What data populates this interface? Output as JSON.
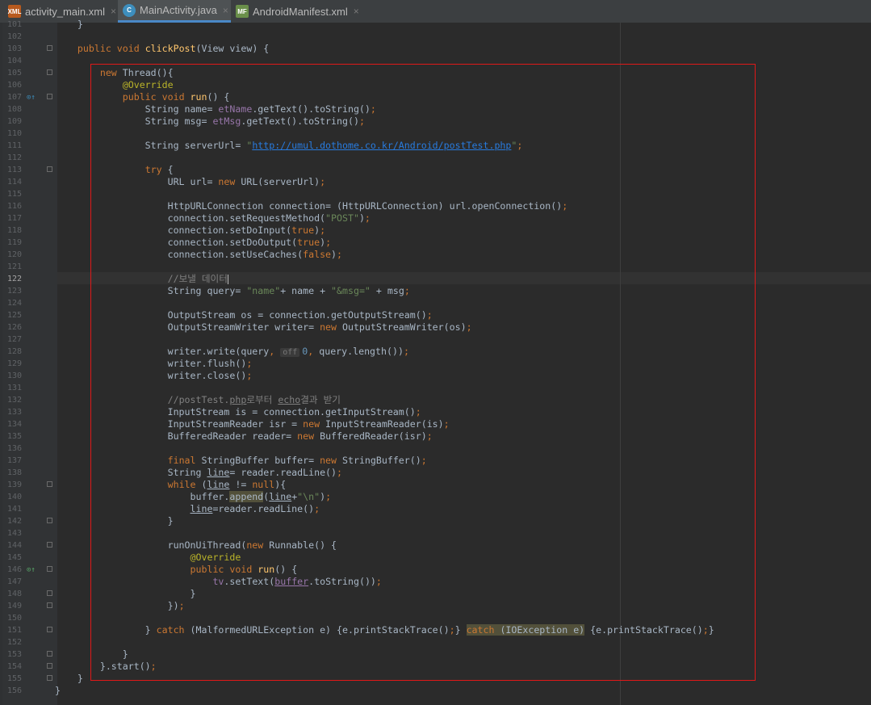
{
  "tabs": [
    {
      "label": "activity_main.xml",
      "icon": "xml-file-icon",
      "active": false,
      "icon_text": "XML"
    },
    {
      "label": "MainActivity.java",
      "icon": "java-class-icon",
      "active": true,
      "icon_text": "C"
    },
    {
      "label": "AndroidManifest.xml",
      "icon": "manifest-file-icon",
      "active": false,
      "icon_text": "MF"
    }
  ],
  "close_glyph": "×",
  "current_line": 122,
  "colors": {
    "keyword": "#cc7832",
    "string": "#6a8759",
    "annotation": "#bbb529",
    "field": "#9876aa",
    "method_decl": "#ffc66d",
    "comment": "#808080",
    "highlight_box": "#e01818"
  },
  "lines": [
    {
      "n": 101,
      "html": "    }"
    },
    {
      "n": 102,
      "html": ""
    },
    {
      "n": 103,
      "html": "    <span class='kw'>public void</span> <span class='fn'>clickPost</span>(View view) {"
    },
    {
      "n": 104,
      "html": ""
    },
    {
      "n": 105,
      "html": "        <span class='kw'>new</span> Thread(){"
    },
    {
      "n": 106,
      "html": "            <span class='ann'>@Override</span>"
    },
    {
      "n": 107,
      "html": "            <span class='kw'>public void</span> <span class='fn'>run</span>() {"
    },
    {
      "n": 108,
      "html": "                String name= <span class='fld'>etName</span>.getText().toString()<span class='kw'>;</span>"
    },
    {
      "n": 109,
      "html": "                String msg= <span class='fld'>etMsg</span>.getText().toString()<span class='kw'>;</span>"
    },
    {
      "n": 110,
      "html": ""
    },
    {
      "n": 111,
      "html": "                String serverUrl= <span class='str'>\"<span class='url'>http://umul.dothome.co.kr/Android/postTest.php</span>\"</span><span class='kw'>;</span>"
    },
    {
      "n": 112,
      "html": ""
    },
    {
      "n": 113,
      "html": "                <span class='kw'>try</span> {"
    },
    {
      "n": 114,
      "html": "                    URL url= <span class='kw'>new</span> URL(serverUrl)<span class='kw'>;</span>"
    },
    {
      "n": 115,
      "html": ""
    },
    {
      "n": 116,
      "html": "                    HttpURLConnection connection= (HttpURLConnection) url.openConnection()<span class='kw'>;</span>"
    },
    {
      "n": 117,
      "html": "                    connection.setRequestMethod(<span class='str'>\"POST\"</span>)<span class='kw'>;</span>"
    },
    {
      "n": 118,
      "html": "                    connection.setDoInput(<span class='kw'>true</span>)<span class='kw'>;</span>"
    },
    {
      "n": 119,
      "html": "                    connection.setDoOutput(<span class='kw'>true</span>)<span class='kw'>;</span>"
    },
    {
      "n": 120,
      "html": "                    connection.setUseCaches(<span class='kw'>false</span>)<span class='kw'>;</span>"
    },
    {
      "n": 121,
      "html": ""
    },
    {
      "n": 122,
      "html": "                    <span class='cmt'>//보낼 데이터</span><span class='cursor'></span>"
    },
    {
      "n": 123,
      "html": "                    String query= <span class='str'>\"name\"</span>+ name + <span class='str'>\"&amp;msg=\"</span> + msg<span class='kw'>;</span>"
    },
    {
      "n": 124,
      "html": ""
    },
    {
      "n": 125,
      "html": "                    OutputStream os = connection.getOutputStream()<span class='kw'>;</span>"
    },
    {
      "n": 126,
      "html": "                    OutputStreamWriter writer= <span class='kw'>new</span> OutputStreamWriter(os)<span class='kw'>;</span>"
    },
    {
      "n": 127,
      "html": ""
    },
    {
      "n": 128,
      "html": "                    writer.write(query<span class='kw'>,</span> <span class='hint'>off</span><span style='color:#6897bb'>0</span><span class='kw'>,</span> query.length())<span class='kw'>;</span>"
    },
    {
      "n": 129,
      "html": "                    writer.flush()<span class='kw'>;</span>"
    },
    {
      "n": 130,
      "html": "                    writer.close()<span class='kw'>;</span>"
    },
    {
      "n": 131,
      "html": ""
    },
    {
      "n": 132,
      "html": "                    <span class='cmt'>//postTest.<span class='ul'>php</span>로부터 <span class='ul'>echo</span>결과 받기</span>"
    },
    {
      "n": 133,
      "html": "                    InputStream is = connection.getInputStream()<span class='kw'>;</span>"
    },
    {
      "n": 134,
      "html": "                    InputStreamReader isr = <span class='kw'>new</span> InputStreamReader(is)<span class='kw'>;</span>"
    },
    {
      "n": 135,
      "html": "                    BufferedReader reader= <span class='kw'>new</span> BufferedReader(isr)<span class='kw'>;</span>"
    },
    {
      "n": 136,
      "html": ""
    },
    {
      "n": 137,
      "html": "                    <span class='kw'>final</span> StringBuffer buffer= <span class='kw'>new</span> StringBuffer()<span class='kw'>;</span>"
    },
    {
      "n": 138,
      "html": "                    String <span class='ul'>line</span>= reader.readLine()<span class='kw'>;</span>"
    },
    {
      "n": 139,
      "html": "                    <span class='kw'>while</span> (<span class='ul'>line</span> != <span class='kw'>null</span>){"
    },
    {
      "n": 140,
      "html": "                        buffer.<span class='warn'>append</span>(<span class='ul'>line</span>+<span class='str'>\"\\n\"</span>)<span class='kw'>;</span>"
    },
    {
      "n": 141,
      "html": "                        <span class='ul'>line</span>=reader.readLine()<span class='kw'>;</span>"
    },
    {
      "n": 142,
      "html": "                    }"
    },
    {
      "n": 143,
      "html": ""
    },
    {
      "n": 144,
      "html": "                    runOnUiThread(<span class='kw'>new</span> Runnable() {"
    },
    {
      "n": 145,
      "html": "                        <span class='ann'>@Override</span>"
    },
    {
      "n": 146,
      "html": "                        <span class='kw'>public void</span> <span class='fn'>run</span>() {"
    },
    {
      "n": 147,
      "html": "                            <span class='fld'>tv</span>.setText(<span class='ul fld'>buffer</span>.toString())<span class='kw'>;</span>"
    },
    {
      "n": 148,
      "html": "                        }"
    },
    {
      "n": 149,
      "html": "                    })<span class='kw'>;</span>"
    },
    {
      "n": 150,
      "html": ""
    },
    {
      "n": 151,
      "html": "                } <span class='kw'>catch</span> (MalformedURLException e) {e.printStackTrace()<span class='kw'>;</span>} <span class='warn'><span class='kw'>catch</span> (IOException e)</span> {e.printStackTrace()<span class='kw'>;</span>}"
    },
    {
      "n": 152,
      "html": ""
    },
    {
      "n": 153,
      "html": "            }"
    },
    {
      "n": 154,
      "html": "        }.start()<span class='kw'>;</span>"
    },
    {
      "n": 155,
      "html": "    }"
    },
    {
      "n": 156,
      "html": "}"
    }
  ],
  "folds": [
    103,
    105,
    107,
    113,
    139,
    142,
    144,
    146,
    148,
    149,
    151,
    153,
    154,
    155
  ],
  "override_markers": [
    {
      "line": 107,
      "glyph": "⊙↑",
      "color": "#3d8ebd"
    },
    {
      "line": 146,
      "glyph": "⊙↑",
      "color": "#59a869"
    }
  ]
}
